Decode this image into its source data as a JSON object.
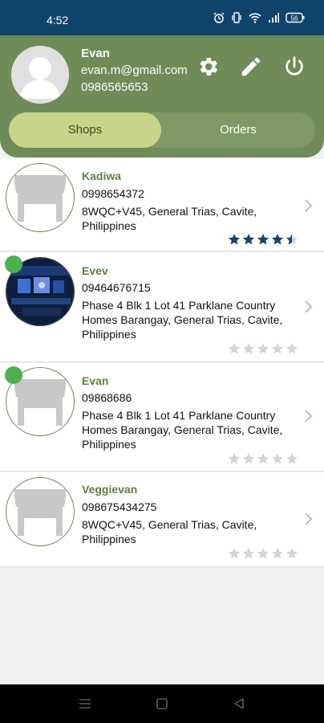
{
  "status_bar": {
    "time": "4:52",
    "battery": "56"
  },
  "profile": {
    "name": "Evan",
    "email": "evan.m@gmail.com",
    "phone": "0986565653",
    "icons": [
      "gear-icon",
      "pencil-icon",
      "power-icon"
    ]
  },
  "tabs": {
    "shops": "Shops",
    "orders": "Orders",
    "selected": "Shops"
  },
  "shops": [
    {
      "name": "Kadiwa",
      "phone": "0998654372",
      "address": "8WQC+V45, General Trias, Cavite, Philippines",
      "rating": 4.5,
      "online": false,
      "image": "store-icon"
    },
    {
      "name": "Evev",
      "phone": "09464676715",
      "address": "Phase 4 Blk 1 Lot 41 Parklane Country Homes Barangay, General Trias, Cavite, Philippines",
      "rating": 0,
      "online": true,
      "image": "shop-photo"
    },
    {
      "name": "Evan",
      "phone": "09868686",
      "address": "Phase 4 Blk 1 Lot 41 Parklane Country Homes Barangay, General Trias, Cavite, Philippines",
      "rating": 0,
      "online": true,
      "image": "store-icon"
    },
    {
      "name": "Veggievan",
      "phone": "098675434275",
      "address": "8WQC+V45, General Trias, Cavite, Philippines",
      "rating": 0,
      "online": false,
      "image": "store-icon"
    }
  ],
  "colors": {
    "status_bar": "#10436a",
    "header": "#6f8b57",
    "tab_selected": "#c7d48a",
    "shop_name": "#5e7e45",
    "star_filled": "#17466e",
    "star_empty": "#d4d4d4",
    "online_dot": "#4caf50"
  }
}
